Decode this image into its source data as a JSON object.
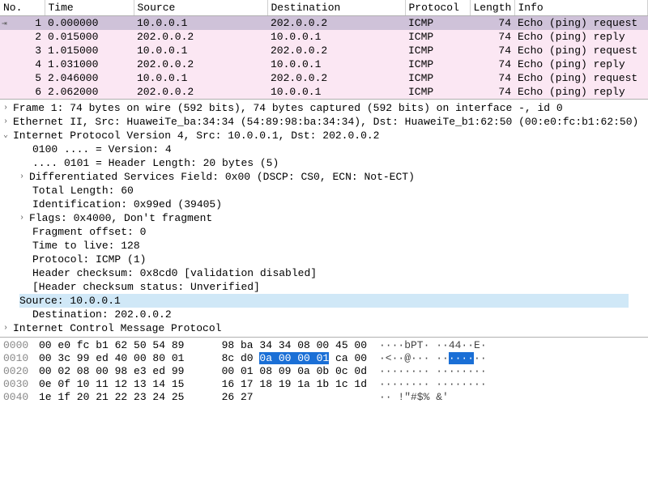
{
  "columns": {
    "no": "No.",
    "time": "Time",
    "src": "Source",
    "dst": "Destination",
    "proto": "Protocol",
    "len": "Length",
    "info": "Info"
  },
  "packets": [
    {
      "no": "1",
      "time": "0.000000",
      "src": "10.0.0.1",
      "dst": "202.0.0.2",
      "proto": "ICMP",
      "len": "74",
      "info": "Echo (ping) request",
      "sel": true
    },
    {
      "no": "2",
      "time": "0.015000",
      "src": "202.0.0.2",
      "dst": "10.0.0.1",
      "proto": "ICMP",
      "len": "74",
      "info": "Echo (ping) reply"
    },
    {
      "no": "3",
      "time": "1.015000",
      "src": "10.0.0.1",
      "dst": "202.0.0.2",
      "proto": "ICMP",
      "len": "74",
      "info": "Echo (ping) request"
    },
    {
      "no": "4",
      "time": "1.031000",
      "src": "202.0.0.2",
      "dst": "10.0.0.1",
      "proto": "ICMP",
      "len": "74",
      "info": "Echo (ping) reply"
    },
    {
      "no": "5",
      "time": "2.046000",
      "src": "10.0.0.1",
      "dst": "202.0.0.2",
      "proto": "ICMP",
      "len": "74",
      "info": "Echo (ping) request"
    },
    {
      "no": "6",
      "time": "2.062000",
      "src": "202.0.0.2",
      "dst": "10.0.0.1",
      "proto": "ICMP",
      "len": "74",
      "info": "Echo (ping) reply"
    }
  ],
  "details": {
    "frame": "Frame 1: 74 bytes on wire (592 bits), 74 bytes captured (592 bits) on interface -, id 0",
    "eth": "Ethernet II, Src: HuaweiTe_ba:34:34 (54:89:98:ba:34:34), Dst: HuaweiTe_b1:62:50 (00:e0:fc:b1:62:50)",
    "ip_header": "Internet Protocol Version 4, Src: 10.0.0.1, Dst: 202.0.0.2",
    "ip": {
      "version": "0100 .... = Version: 4",
      "hdrlen": ".... 0101 = Header Length: 20 bytes (5)",
      "dsf": "Differentiated Services Field: 0x00 (DSCP: CS0, ECN: Not-ECT)",
      "totlen": "Total Length: 60",
      "ident": "Identification: 0x99ed (39405)",
      "flags": "Flags: 0x4000, Don't fragment",
      "fragoff": "Fragment offset: 0",
      "ttl": "Time to live: 128",
      "proto": "Protocol: ICMP (1)",
      "chksum": "Header checksum: 0x8cd0 [validation disabled]",
      "chkstatus": "[Header checksum status: Unverified]",
      "src": "Source: 10.0.0.1",
      "dst": "Destination: 202.0.0.2"
    },
    "icmp": "Internet Control Message Protocol"
  },
  "hex": [
    {
      "off": "0000",
      "b1": "00 e0 fc b1 62 50 54 89",
      "b2": "  98 ba 34 34 08 00 45 00",
      "asc": "····bPT· ··44··E·"
    },
    {
      "off": "0010",
      "b1": "00 3c 99 ed 40 00 80 01",
      "b2_pre": "  8c d0 ",
      "b2_sel": "0a 00 00 01",
      "b2_post": " ca 00",
      "asc_pre": "·<··@··· ··",
      "asc_sel": "····",
      "asc_post": "··"
    },
    {
      "off": "0020",
      "b1": "00 02 08 00 98 e3 ed 99",
      "b2": "  00 01 08 09 0a 0b 0c 0d",
      "asc": "········ ········"
    },
    {
      "off": "0030",
      "b1": "0e 0f 10 11 12 13 14 15",
      "b2": "  16 17 18 19 1a 1b 1c 1d",
      "asc": "········ ········"
    },
    {
      "off": "0040",
      "b1": "1e 1f 20 21 22 23 24 25",
      "b2": "  26 27",
      "asc": "·· !\"#$% &'"
    }
  ]
}
